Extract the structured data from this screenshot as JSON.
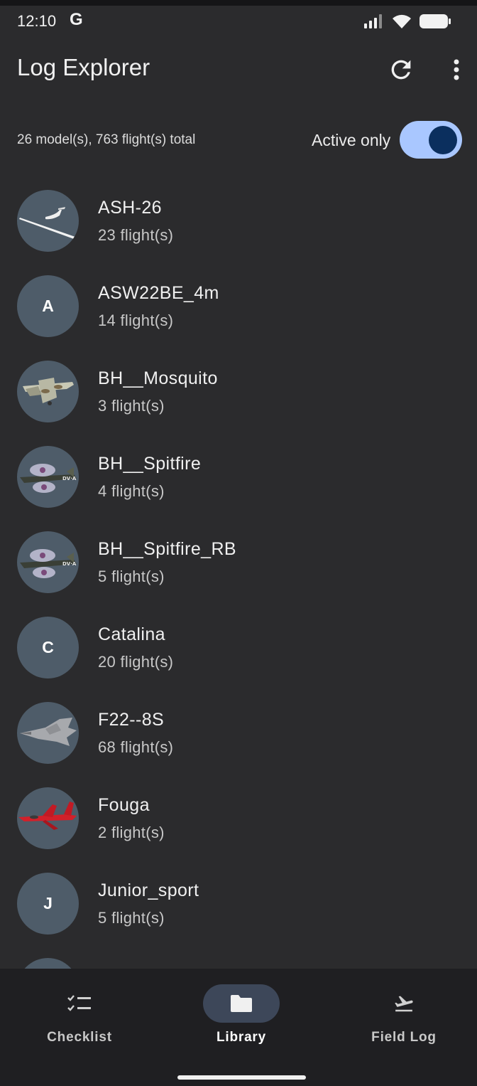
{
  "status_bar": {
    "time": "12:10",
    "g_logo": "G"
  },
  "appbar": {
    "title": "Log Explorer",
    "refresh_icon": "refresh-icon",
    "more_icon": "more-vert-icon"
  },
  "summary": {
    "count_text": "26 model(s), 763 flight(s) total",
    "active_label": "Active only",
    "active_on": true
  },
  "models": [
    {
      "name": "ASH-26",
      "flights": "23 flight(s)",
      "thumb": "glider"
    },
    {
      "name": "ASW22BE_4m",
      "flights": "14 flight(s)",
      "initial": "A"
    },
    {
      "name": "BH__Mosquito",
      "flights": "3 flight(s)",
      "thumb": "mosquito"
    },
    {
      "name": "BH__Spitfire",
      "flights": "4 flight(s)",
      "thumb": "spitfire"
    },
    {
      "name": "BH__Spitfire_RB",
      "flights": "5 flight(s)",
      "thumb": "spitfire"
    },
    {
      "name": "Catalina",
      "flights": "20 flight(s)",
      "initial": "C"
    },
    {
      "name": "F22--8S",
      "flights": "68 flight(s)",
      "thumb": "f22"
    },
    {
      "name": "Fouga",
      "flights": "2 flight(s)",
      "thumb": "fouga"
    },
    {
      "name": "Junior_sport",
      "flights": "5 flight(s)",
      "initial": "J"
    }
  ],
  "bottom_nav": {
    "items": [
      {
        "label": "Checklist",
        "icon": "checklist-icon"
      },
      {
        "label": "Library",
        "icon": "folder-icon",
        "active": true
      },
      {
        "label": "Field Log",
        "icon": "flight-takeoff-icon"
      }
    ]
  },
  "colors": {
    "background": "#2b2b2d",
    "toggle_track": "#a9c7ff",
    "toggle_knob": "#0b2f5e",
    "avatar_bg": "#4e5c69",
    "nav_bg": "#1f1f22"
  }
}
